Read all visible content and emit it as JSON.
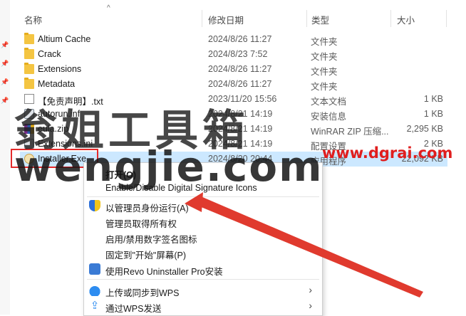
{
  "columns": {
    "name": "名称",
    "date": "修改日期",
    "type": "类型",
    "size": "大小"
  },
  "files": [
    {
      "name": "Altium Cache",
      "date": "2024/8/26 11:27",
      "type": "文件夹",
      "size": "",
      "icon": "folder-icon"
    },
    {
      "name": "Crack",
      "date": "2024/8/23 7:52",
      "type": "文件夹",
      "size": "",
      "icon": "folder-icon"
    },
    {
      "name": "Extensions",
      "date": "2024/8/26 11:27",
      "type": "文件夹",
      "size": "",
      "icon": "folder-icon"
    },
    {
      "name": "Metadata",
      "date": "2024/8/26 11:27",
      "type": "文件夹",
      "size": "",
      "icon": "folder-icon"
    },
    {
      "name": "【免责声明】.txt",
      "date": "2023/11/20 15:56",
      "type": "文本文档",
      "size": "1 KB",
      "icon": "text-file-icon"
    },
    {
      "name": "autorun.inf",
      "date": "2024/8/21 14:19",
      "type": "安装信息",
      "size": "1 KB",
      "icon": "setup-info-icon"
    },
    {
      "name": "eula.zip",
      "date": "2024/8/21 14:19",
      "type": "WinRAR ZIP 压缩...",
      "size": "2,295 KB",
      "icon": "winrar-icon"
    },
    {
      "name": "Extensions.ini",
      "date": "2024/8/21 14:19",
      "type": "配置设置",
      "size": "2 KB",
      "icon": "config-icon"
    },
    {
      "name": "Installer.Exe",
      "date": "2024/8/20 20:44",
      "type": "应用程序",
      "size": "22,092 KB",
      "icon": "installer-icon"
    }
  ],
  "context_menu": {
    "open": "打开(O)",
    "signature_icons": "Enable/Disable Digital Signature Icons",
    "run_as_admin": "以管理员身份运行(A)",
    "take_ownership": "管理员取得所有权",
    "toggle_signature_icons": "启用/禁用数字签名图标",
    "pin_start": "固定到\"开始\"屏幕(P)",
    "revo_install": "使用Revo Uninstaller Pro安装",
    "wps_sync": "上传或同步到WPS",
    "wps_send": "通过WPS发送"
  },
  "watermark": {
    "cn": "翁姐工具箱",
    "en": "wengjie.com",
    "url": "www.dgrai.com"
  },
  "colors": {
    "selection": "#cce8ff",
    "highlight_box": "#e52b2b",
    "arrow": "#e03a2e",
    "watermark_url": "#e01e1e"
  }
}
